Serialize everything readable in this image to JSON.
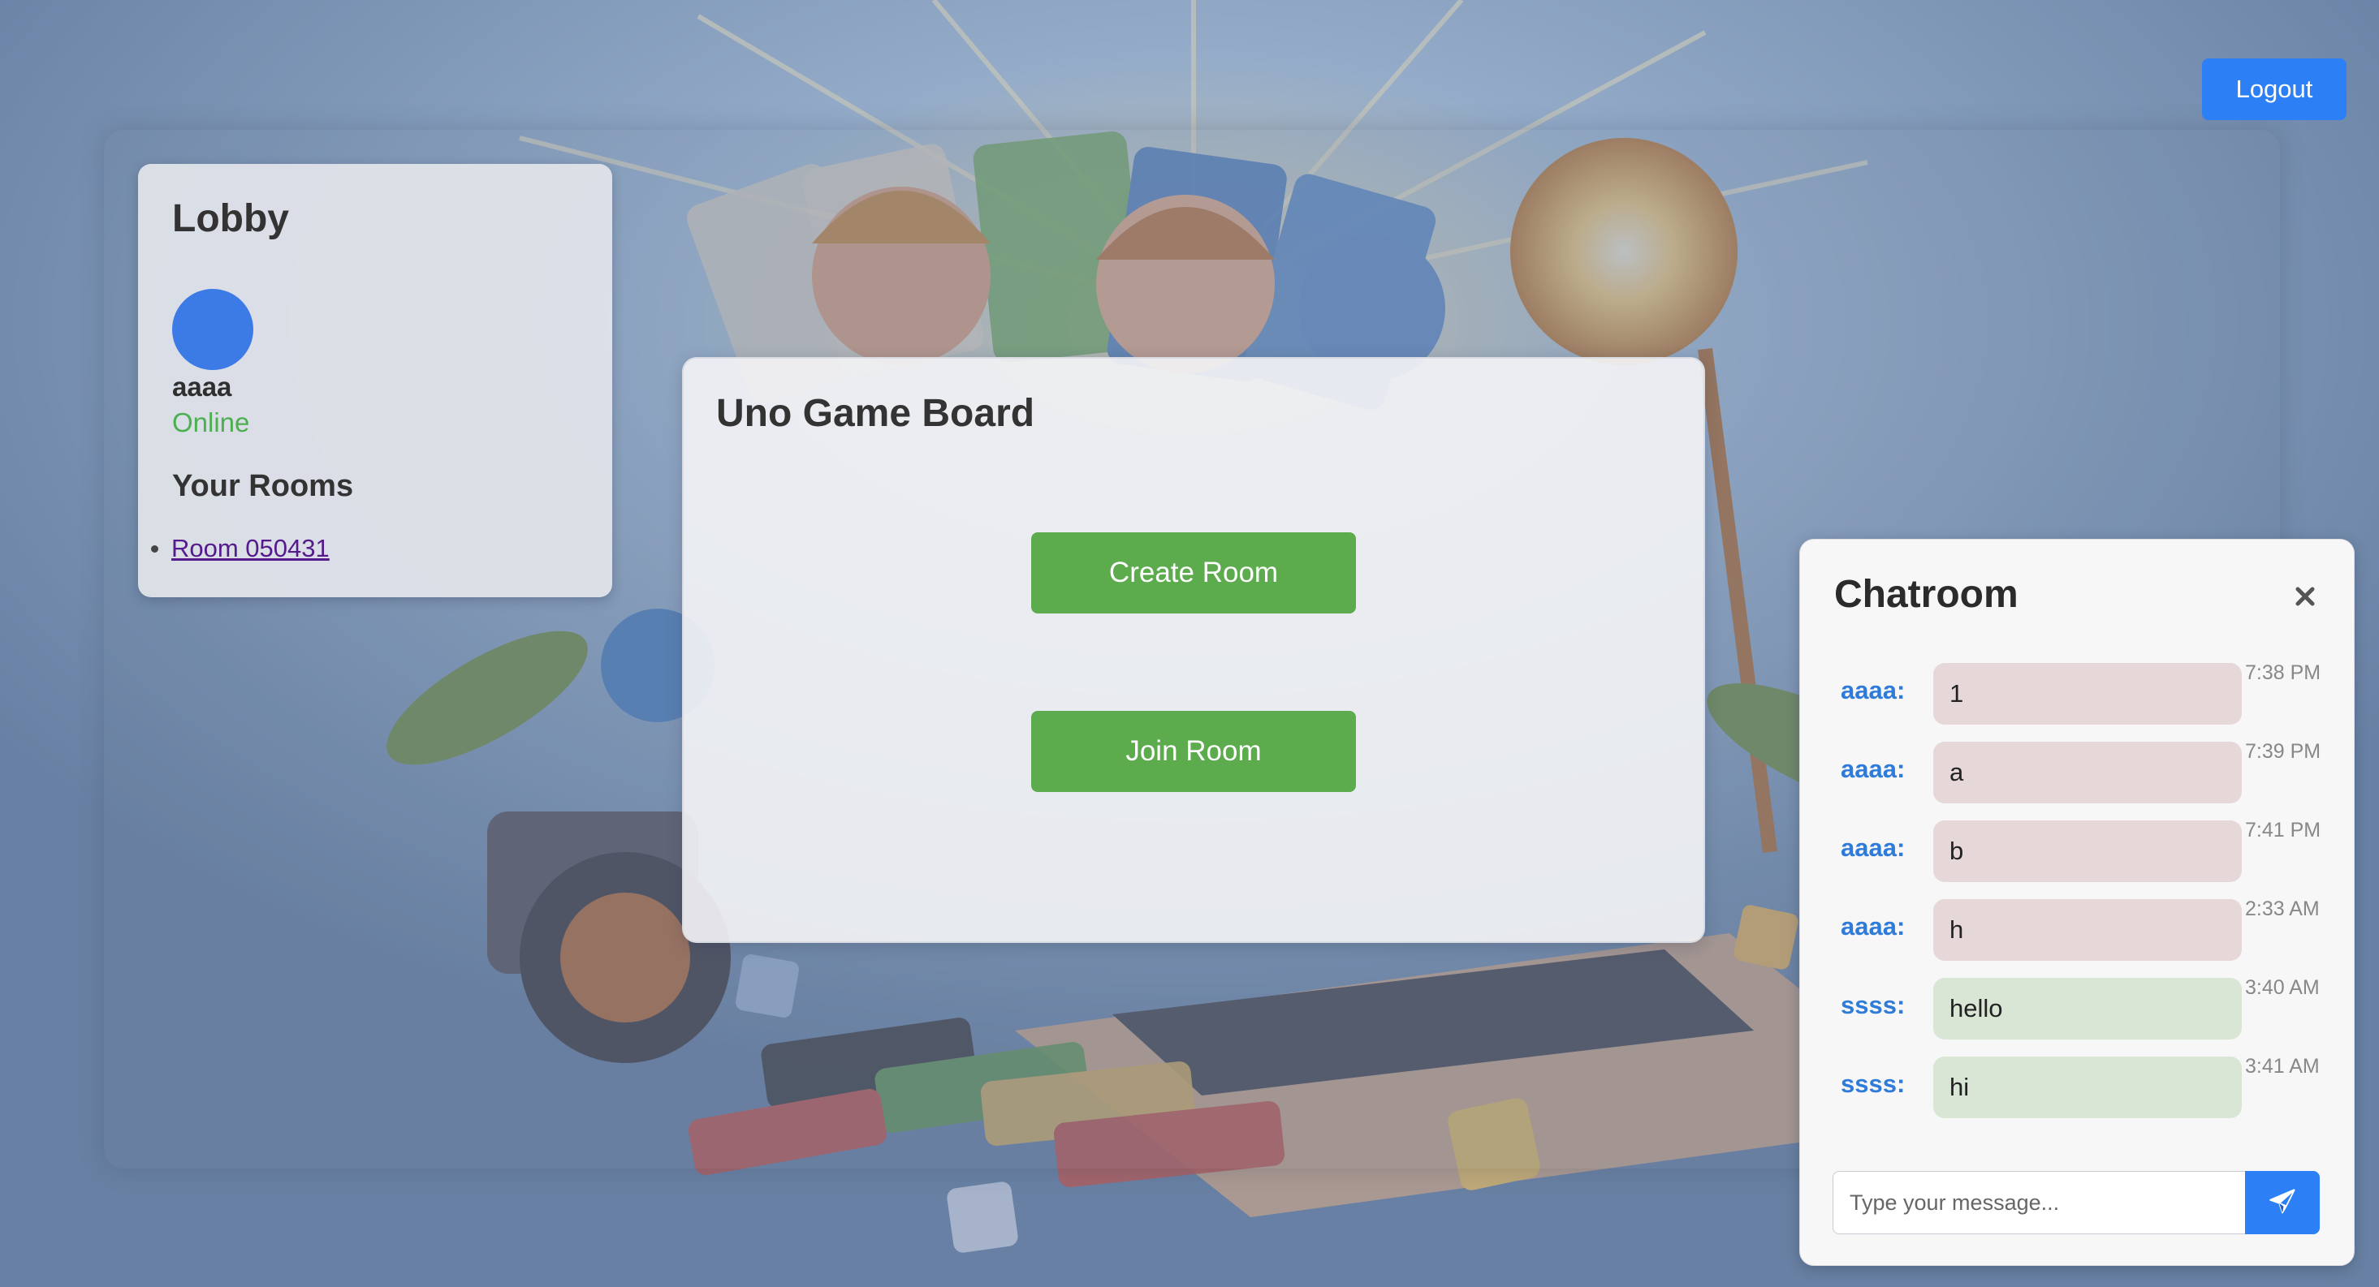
{
  "header": {
    "logout_label": "Logout"
  },
  "lobby": {
    "title": "Lobby",
    "username": "aaaa",
    "status": "Online",
    "rooms_title": "Your Rooms",
    "rooms": [
      "Room 050431"
    ]
  },
  "board": {
    "title": "Uno Game Board",
    "create_label": "Create Room",
    "join_label": "Join Room"
  },
  "chat": {
    "title": "Chatroom",
    "close_icon": "close-icon",
    "messages": [
      {
        "sender": "aaaa:",
        "text": "1",
        "time": "7:38 PM",
        "color": "#e6d8d8"
      },
      {
        "sender": "aaaa:",
        "text": "a",
        "time": "7:39 PM",
        "color": "#e6d8d8"
      },
      {
        "sender": "aaaa:",
        "text": "b",
        "time": "7:41 PM",
        "color": "#e6d8d8"
      },
      {
        "sender": "aaaa:",
        "text": "h",
        "time": "2:33 AM",
        "color": "#e6d8d8"
      },
      {
        "sender": "ssss:",
        "text": "hello",
        "time": "3:40 AM",
        "color": "#d9e6d5"
      },
      {
        "sender": "ssss:",
        "text": "hi",
        "time": "3:41 AM",
        "color": "#d9e6d5"
      }
    ],
    "input_placeholder": "Type your message...",
    "send_icon": "send-icon"
  },
  "colors": {
    "primary": "#2d7ff5",
    "button_green": "#5cab4d",
    "online": "#4caf50",
    "sender": "#2e7bd9"
  }
}
